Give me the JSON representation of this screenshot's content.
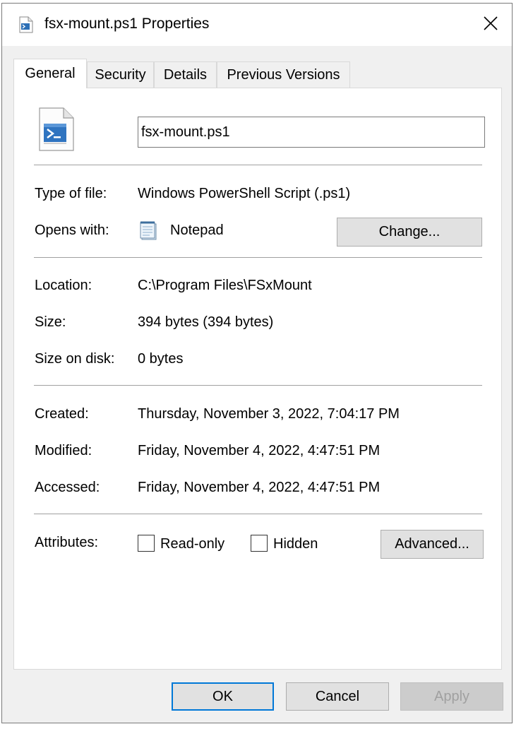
{
  "window": {
    "title": "fsx-mount.ps1 Properties",
    "close_glyph": "✕"
  },
  "tabs": [
    {
      "label": "General",
      "active": true
    },
    {
      "label": "Security"
    },
    {
      "label": "Details"
    },
    {
      "label": "Previous Versions"
    }
  ],
  "general": {
    "file_name": "fsx-mount.ps1",
    "type_label": "Type of file:",
    "type_value": "Windows PowerShell Script (.ps1)",
    "opens_label": "Opens with:",
    "opens_value": "Notepad",
    "change_button": "Change...",
    "location_label": "Location:",
    "location_value": "C:\\Program Files\\FSxMount",
    "size_label": "Size:",
    "size_value": "394 bytes (394 bytes)",
    "size_on_disk_label": "Size on disk:",
    "size_on_disk_value": "0 bytes",
    "created_label": "Created:",
    "created_value": "Thursday, November 3, 2022, 7:04:17 PM",
    "modified_label": "Modified:",
    "modified_value": "Friday, November 4, 2022, 4:47:51 PM",
    "accessed_label": "Accessed:",
    "accessed_value": "Friday, November 4, 2022, 4:47:51 PM",
    "attributes_label": "Attributes:",
    "readonly_label": "Read-only",
    "readonly_checked": false,
    "hidden_label": "Hidden",
    "hidden_checked": false,
    "advanced_button": "Advanced..."
  },
  "footer": {
    "ok": "OK",
    "cancel": "Cancel",
    "apply": "Apply",
    "apply_enabled": false
  },
  "icons": {
    "title_icon": "powershell-script-icon",
    "file_icon": "powershell-script-icon",
    "opens_icon": "notepad-icon",
    "close_icon": "close-icon"
  },
  "colors": {
    "accent": "#0078d7",
    "dialog_bg": "#f0f0f0",
    "button_bg": "#e1e1e1"
  }
}
